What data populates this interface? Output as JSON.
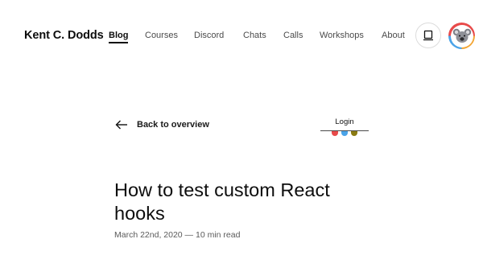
{
  "site": {
    "brand": "Kent C. Dodds"
  },
  "nav": {
    "items": [
      {
        "label": "Blog",
        "active": true
      },
      {
        "label": "Courses"
      },
      {
        "label": "Discord"
      },
      {
        "label": "Chats"
      },
      {
        "label": "Calls"
      },
      {
        "label": "Workshops"
      },
      {
        "label": "About"
      }
    ]
  },
  "header_actions": {
    "theme_icon": "laptop-icon",
    "avatar_icon": "koala-avatar"
  },
  "article": {
    "back_label": "Back to overview",
    "title": "How to test custom React hooks",
    "meta": "March 22nd, 2020 — 10 min read"
  },
  "login": {
    "label": "Login",
    "dot_colors": [
      "#e84a4a",
      "#4aa3e8",
      "#8a7a12"
    ]
  },
  "colors": {
    "text": "#0d0d0d",
    "muted": "#5a5a5a",
    "border": "#dcdcdc"
  }
}
